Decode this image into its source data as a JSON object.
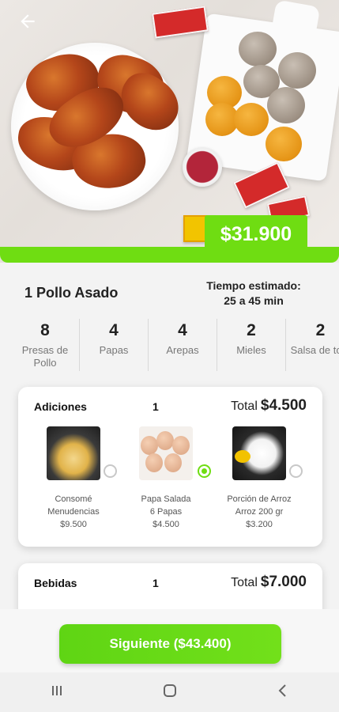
{
  "product": {
    "price": "$31.900",
    "title": "1 Pollo Asado",
    "time_label": "Tiempo estimado:",
    "time_value": "25 a 45 min"
  },
  "stats": [
    {
      "value": "8",
      "label": "Presas de Pollo"
    },
    {
      "value": "4",
      "label": "Papas"
    },
    {
      "value": "4",
      "label": "Arepas"
    },
    {
      "value": "2",
      "label": "Mieles"
    },
    {
      "value": "2",
      "label": "Salsa de tom"
    }
  ],
  "adiciones": {
    "title": "Adiciones",
    "count": "1",
    "total_label": "Total",
    "total_amount": "$4.500",
    "items": [
      {
        "name": "Consomé",
        "detail": "Menudencias",
        "price": "$9.500",
        "selected": false
      },
      {
        "name": "Papa Salada",
        "detail": "6 Papas",
        "price": "$4.500",
        "selected": true
      },
      {
        "name": "Porción de Arroz",
        "detail": "Arroz 200 gr",
        "price": "$3.200",
        "selected": false
      }
    ]
  },
  "bebidas": {
    "title": "Bebidas",
    "count": "1",
    "total_label": "Total",
    "total_amount": "$7.000"
  },
  "footer": {
    "next_label": "Siguiente ($43.400)"
  },
  "icons": {
    "back": "arrow-left-icon",
    "recents": "recents-icon",
    "home": "home-icon",
    "nav_back": "chevron-left-icon"
  },
  "colors": {
    "accent": "#6fdd12"
  }
}
